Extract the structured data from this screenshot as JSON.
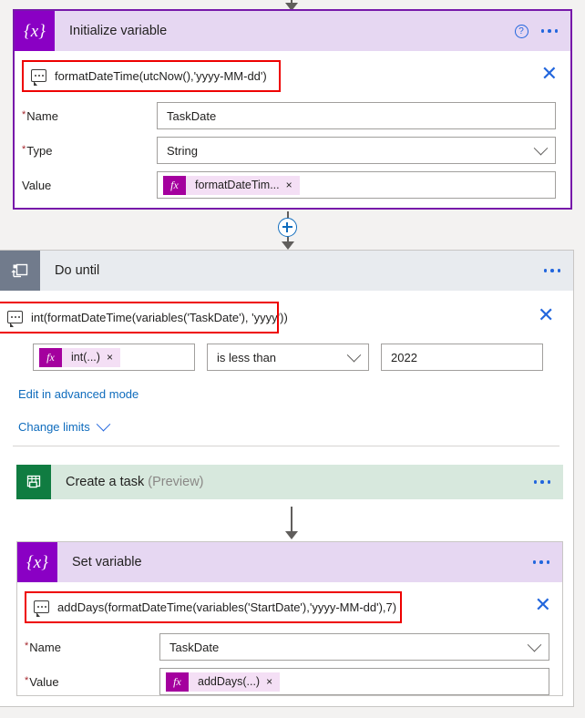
{
  "flow": {
    "steps": [
      {
        "id": "initialize-variable",
        "title": "Initialize variable",
        "icon": "variable-x-icon",
        "icon_color": "#8a00c4",
        "header_color": "#e6d7f2",
        "border_color": "#7719aa",
        "expression": {
          "icon": "expression-tooltip-icon",
          "text": "formatDateTime(utcNow(),'yyyy-MM-dd')",
          "close_label": "✕",
          "highlighted": true
        },
        "fields": [
          {
            "label": "Name",
            "required": true,
            "control": "text",
            "value": "TaskDate"
          },
          {
            "label": "Type",
            "required": true,
            "control": "dropdown",
            "value": "String"
          },
          {
            "label": "Value",
            "required": false,
            "control": "token",
            "token": {
              "fx": "fx",
              "text": "formatDateTim...",
              "remove": "×"
            }
          }
        ],
        "help_icon": "help-question-icon",
        "menu_icon": "more-options-icon"
      },
      {
        "id": "do-until",
        "title": "Do until",
        "icon": "do-until-loop-icon",
        "icon_color": "#717b8c",
        "header_color": "#e8ebef",
        "expression": {
          "icon": "expression-tooltip-icon",
          "text": "int(formatDateTime(variables('TaskDate'), 'yyyy'))",
          "close_label": "✕",
          "highlighted": true
        },
        "condition": {
          "left_token": {
            "fx": "fx",
            "text": "int(...)",
            "remove": "×"
          },
          "operator": "is less than",
          "right_value": "2022"
        },
        "links": [
          {
            "label": "Edit in advanced mode",
            "chevron": false
          },
          {
            "label": "Change limits",
            "chevron": true
          }
        ],
        "menu_icon": "more-options-icon"
      },
      {
        "id": "create-a-task",
        "title": "Create a task",
        "title_suffix": "(Preview)",
        "icon": "planner-board-icon",
        "icon_color": "#107c41",
        "header_color": "#d7e8dd",
        "menu_icon": "more-options-icon"
      },
      {
        "id": "set-variable",
        "title": "Set variable",
        "icon": "variable-x-icon",
        "icon_color": "#8a00c4",
        "header_color": "#e6d7f2",
        "expression": {
          "icon": "expression-tooltip-icon",
          "text": "addDays(formatDateTime(variables('StartDate'),'yyyy-MM-dd'),7)",
          "close_label": "✕",
          "highlighted": true
        },
        "fields": [
          {
            "label": "Name",
            "required": true,
            "control": "dropdown",
            "value": "TaskDate"
          },
          {
            "label": "Value",
            "required": true,
            "control": "token",
            "token": {
              "fx": "fx",
              "text": "addDays(...)",
              "remove": "×"
            }
          }
        ],
        "menu_icon": "more-options-icon"
      }
    ],
    "connectors": {
      "add_step_label": "+",
      "add_step_icon": "add-step-plus-icon"
    }
  },
  "colors": {
    "accent_purple": "#8a00c4",
    "accent_blue": "#0f6cbd",
    "annotation_red": "#ee0000",
    "token_magenta": "#a4009e",
    "planner_green": "#107c41",
    "required_red": "#a4262c"
  }
}
